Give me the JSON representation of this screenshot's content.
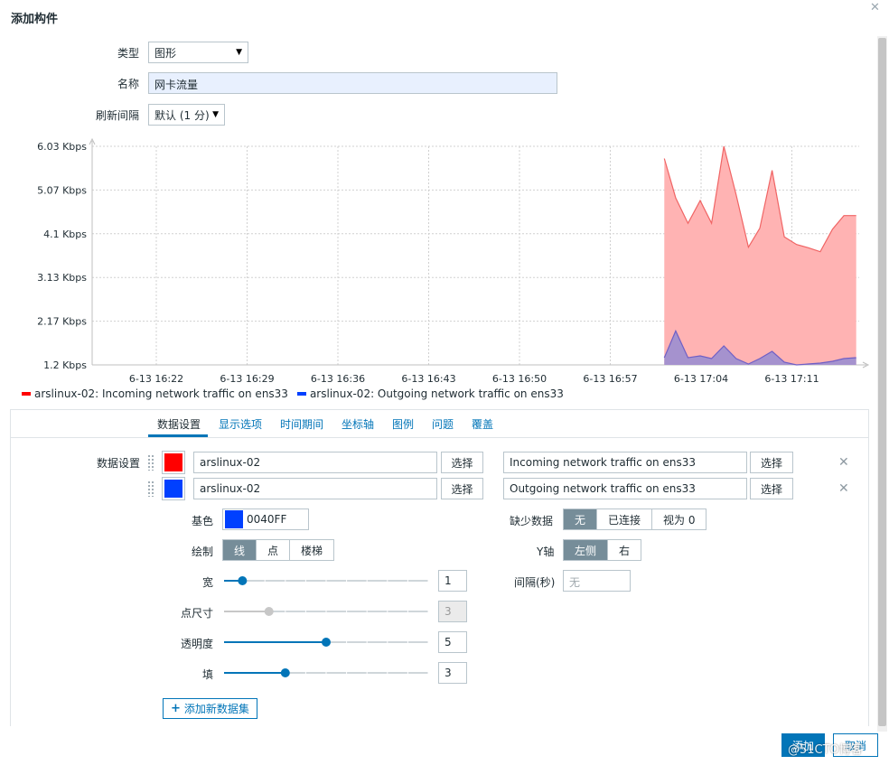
{
  "dialog": {
    "title": "添加构件",
    "close_icon": "✕"
  },
  "form": {
    "type_label": "类型",
    "type_value": "图形",
    "name_label": "名称",
    "name_value": "网卡流量",
    "refresh_label": "刷新间隔",
    "refresh_value": "默认 (1 分)"
  },
  "chart_data": {
    "type": "area",
    "yticks": [
      "6.03 Kbps",
      "5.07 Kbps",
      "4.1 Kbps",
      "3.13 Kbps",
      "2.17 Kbps",
      "1.2 Kbps"
    ],
    "ylim": [
      1.2,
      6.03
    ],
    "xticks": [
      "6-13 16:22",
      "6-13 16:29",
      "6-13 16:36",
      "6-13 16:43",
      "6-13 16:50",
      "6-13 16:57",
      "6-13 17:04",
      "6-13 17:11"
    ],
    "grid": true,
    "legend_placement": "bottom-left",
    "series": [
      {
        "name": "arslinux-02: Incoming network traffic on ens33",
        "color": "#ff0000",
        "x_fraction": [
          0.758,
          0.771,
          0.785,
          0.799,
          0.812,
          0.826,
          0.84,
          0.854,
          0.867,
          0.881,
          0.895,
          0.909,
          0.922,
          0.936,
          0.95,
          0.963,
          0.977
        ],
        "values": [
          5.76,
          4.89,
          4.33,
          4.83,
          4.33,
          6.03,
          4.96,
          3.8,
          4.22,
          5.5,
          4.03,
          3.86,
          3.79,
          3.7,
          4.2,
          4.5,
          4.5
        ]
      },
      {
        "name": "arslinux-02: Outgoing network traffic on ens33",
        "color": "#0040ff",
        "x_fraction": [
          0.758,
          0.771,
          0.785,
          0.799,
          0.812,
          0.826,
          0.84,
          0.854,
          0.867,
          0.881,
          0.895,
          0.909,
          0.922,
          0.936,
          0.95,
          0.963,
          0.977
        ],
        "values": [
          1.36,
          1.95,
          1.36,
          1.4,
          1.34,
          1.62,
          1.34,
          1.22,
          1.34,
          1.5,
          1.26,
          1.2,
          1.22,
          1.24,
          1.28,
          1.34,
          1.36
        ]
      }
    ]
  },
  "tabs": [
    "数据设置",
    "显示选项",
    "时间期间",
    "坐标轴",
    "图例",
    "问题",
    "覆盖"
  ],
  "datasets": {
    "label": "数据设置",
    "rows": [
      {
        "color": "#ff0000",
        "host": "arslinux-02",
        "host_btn": "选择",
        "item": "Incoming network traffic on ens33",
        "item_btn": "选择",
        "remove_icon": "✕"
      },
      {
        "color": "#0040ff",
        "host": "arslinux-02",
        "host_btn": "选择",
        "item": "Outgoing network traffic on ens33",
        "item_btn": "选择",
        "remove_icon": "✕"
      }
    ]
  },
  "settings": {
    "base_color_label": "基色",
    "base_color_value": "0040FF",
    "base_color": "#0040ff",
    "draw_label": "绘制",
    "draw_options": [
      "线",
      "点",
      "楼梯"
    ],
    "width_label": "宽",
    "width_value": "1",
    "width_fraction": 0.09,
    "point_label": "点尺寸",
    "point_value": "3",
    "point_fraction": 0.22,
    "transparency_label": "透明度",
    "transparency_value": "5",
    "transparency_fraction": 0.5,
    "fill_label": "填",
    "fill_value": "3",
    "fill_fraction": 0.3,
    "missing_label": "缺少数据",
    "missing_options": [
      "无",
      "已连接",
      "视为 0"
    ],
    "yaxis_label": "Y轴",
    "yaxis_options": [
      "左侧",
      "右"
    ],
    "interval_label": "间隔(秒)",
    "interval_placeholder": "无"
  },
  "add_dataset_label": "添加新数据集",
  "footer": {
    "primary_label": "添加",
    "secondary_label": "取消",
    "watermark": "@51CTO博客"
  }
}
